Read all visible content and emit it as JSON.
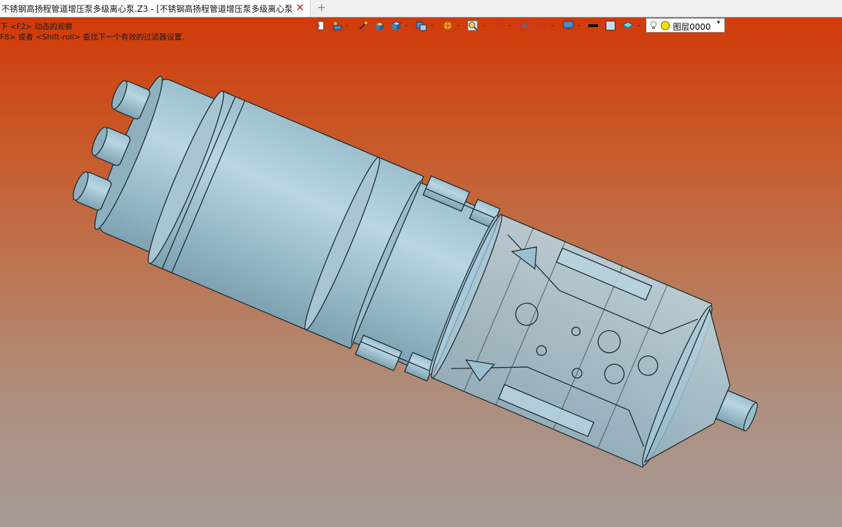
{
  "tab": {
    "title": "不锈钢高扬程管道增压泵多级离心泵.Z3 - [不锈钢高扬程管道增压泵多级离心泵]",
    "close_icon": "close-icon",
    "new_tab_icon": "plus-icon"
  },
  "viewport": {
    "hint_line1": "下 <F2> 动态的观察",
    "hint_line2": "F8> 或者 <Shift-roll> 查找下一个有效的过滤器设置.",
    "background_top": "#d13a09",
    "background_bottom": "#a59a96"
  },
  "toolbar": {
    "layer_label": "图层0000",
    "icons": [
      "pick-filter-icon",
      "assembly-icon",
      "brush-icon",
      "shaded-box-icon",
      "view-cube-icon",
      "display-mode-icon",
      "color-wheel-icon",
      "zoom-icon",
      "axis-icon",
      "frame-icon",
      "section-icon",
      "monitor-icon",
      "line-color-icon",
      "fill-color-icon",
      "layer-stack-icon",
      "lightbulb-icon",
      "layer-state-icon"
    ]
  }
}
